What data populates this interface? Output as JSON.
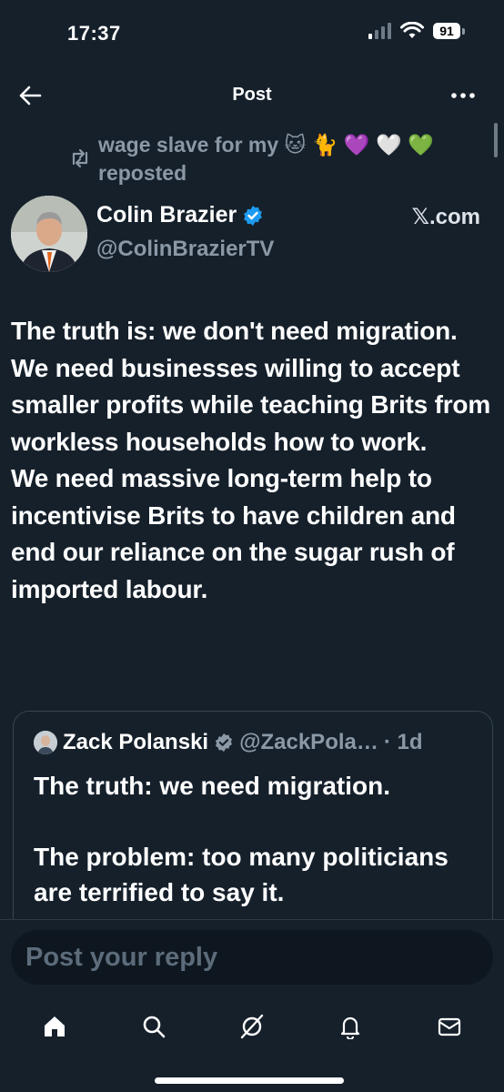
{
  "status_bar": {
    "time": "17:37",
    "battery": "91"
  },
  "header": {
    "title": "Post",
    "back_icon": "back-arrow-icon",
    "more_icon": "more-dots-icon"
  },
  "repost": {
    "text": "wage slave for my 🐱 🐈 💜 🤍 💚 reposted",
    "icon": "repost-icon"
  },
  "author": {
    "name": "Colin Brazier",
    "handle": "@ColinBrazierTV",
    "verified_color": "#1d9bf0",
    "source": "𝕏.com"
  },
  "tweet": {
    "text": "The truth is: we don't need migration.\nWe need businesses willing to accept smaller profits while teaching Brits from workless households how to work.\nWe need massive long-term help to incentivise Brits to have children and end our reliance on the sugar rush of imported labour."
  },
  "quote": {
    "name": "Zack Polanski",
    "handle": "@ZackPola…",
    "time": "· 1d",
    "verified_color": "#8b98a5",
    "text": "The truth: we need migration.\n\nThe problem: too many politicians are terrified to say it."
  },
  "reply": {
    "placeholder": "Post your reply"
  },
  "nav": [
    "home-icon",
    "search-icon",
    "grok-icon",
    "notifications-bell-icon",
    "messages-envelope-icon"
  ],
  "colors": {
    "background": "#15202b",
    "secondary_text": "#8b98a5",
    "accent": "#1d9bf0"
  }
}
